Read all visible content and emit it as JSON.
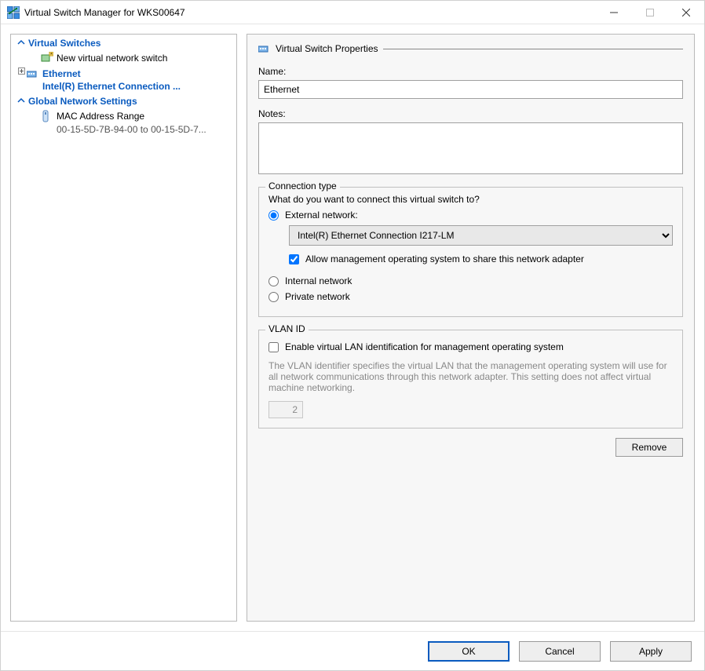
{
  "window": {
    "title": "Virtual Switch Manager for WKS00647"
  },
  "left": {
    "group_switches": "Virtual Switches",
    "new_switch": "New virtual network switch",
    "selected": {
      "name": "Ethernet",
      "sub": "Intel(R) Ethernet Connection ..."
    },
    "group_global": "Global Network Settings",
    "mac_range": "MAC Address Range",
    "mac_range_sub": "00-15-5D-7B-94-00 to 00-15-5D-7..."
  },
  "props": {
    "title": "Virtual Switch Properties",
    "name_label": "Name:",
    "name_value": "Ethernet",
    "notes_label": "Notes:",
    "notes_value": ""
  },
  "conn": {
    "group_title": "Connection type",
    "prompt": "What do you want to connect this virtual switch to?",
    "external": "External network:",
    "adapter": "Intel(R) Ethernet Connection I217-LM",
    "allow_mgmt": "Allow management operating system to share this network adapter",
    "internal": "Internal network",
    "private": "Private network"
  },
  "vlan": {
    "group_title": "VLAN ID",
    "enable": "Enable virtual LAN identification for management operating system",
    "help": "The VLAN identifier specifies the virtual LAN that the management operating system will use for all network communications through this network adapter. This setting does not affect virtual machine networking.",
    "value": "2"
  },
  "buttons": {
    "remove": "Remove",
    "ok": "OK",
    "cancel": "Cancel",
    "apply": "Apply"
  }
}
